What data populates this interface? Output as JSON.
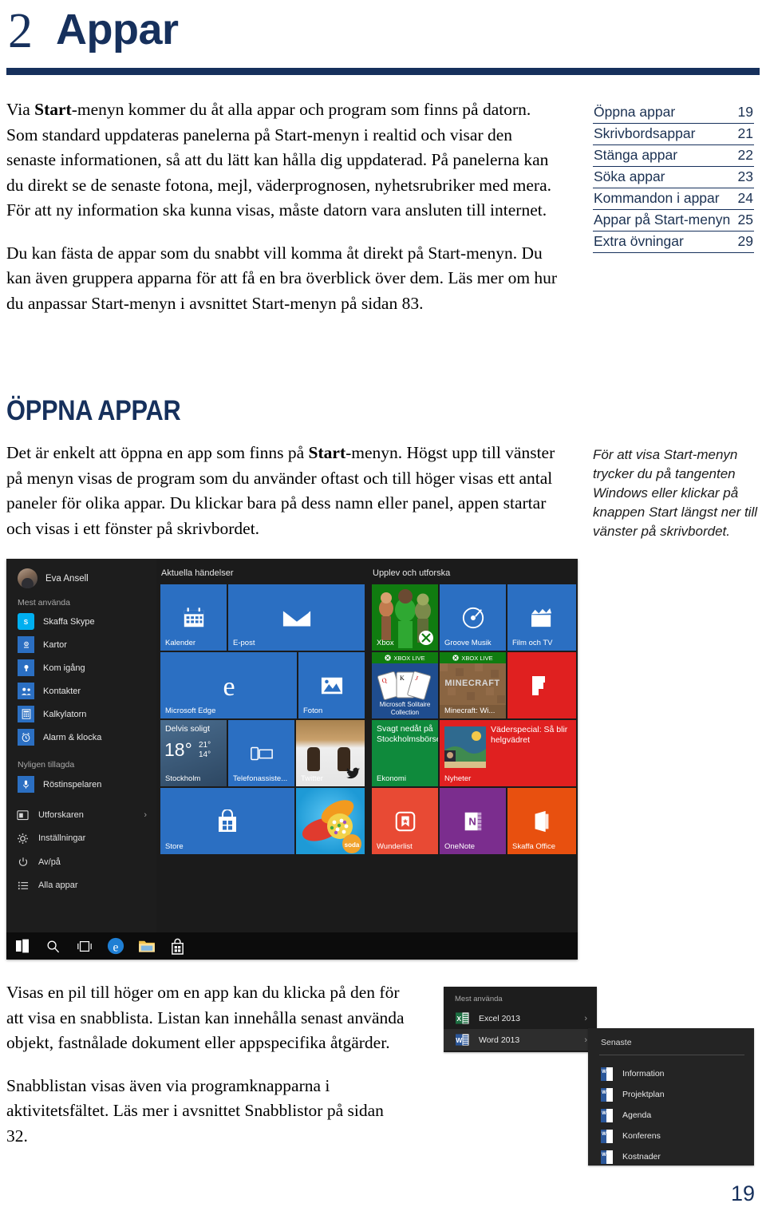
{
  "header": {
    "chapter_number": "2",
    "chapter_title": "Appar"
  },
  "toc": {
    "items": [
      {
        "label": "Öppna appar",
        "page": "19"
      },
      {
        "label": "Skrivbordsappar",
        "page": "21"
      },
      {
        "label": "Stänga appar",
        "page": "22"
      },
      {
        "label": "Söka appar",
        "page": "23"
      },
      {
        "label": "Kommandon i appar",
        "page": "24"
      },
      {
        "label": "Appar på Start-menyn",
        "page": "25"
      },
      {
        "label": "Extra övningar",
        "page": "29"
      }
    ]
  },
  "intro": {
    "para1_a": "Via ",
    "para1_b": "Start",
    "para1_c": "-menyn kommer du åt alla appar och program som finns på datorn. Som standard uppdateras panelerna på Start-menyn i realtid och visar den senaste informationen, så att du lätt kan hålla dig uppdaterad. På panelerna kan du direkt se de senaste fotona, mejl, väderprognosen, nyhetsrubriker med mera. För att ny information ska kunna visas, måste datorn vara ansluten till internet.",
    "para2": "Du kan fästa de appar som du snabbt vill komma åt direkt på Start-menyn. Du kan även gruppera apparna för att få en bra överblick över dem. Läs mer om hur du anpassar Start-menyn i avsnittet Start-menyn på sidan 83."
  },
  "section": {
    "heading": "ÖPPNA APPAR",
    "para_a": "Det är enkelt att öppna en app som finns på ",
    "para_b": "Start",
    "para_c": "-menyn. Högst upp till vänster på menyn visas de program som du använder oftast och till höger visas ett antal paneler för olika appar. Du klickar bara på dess namn eller panel, appen startar och visas i ett fönster på skrivbordet."
  },
  "side_note": "För att visa Start-menyn trycker du på tangenten Windows eller klickar på knappen Start längst ner till vänster på skrivbordet.",
  "start_menu": {
    "account_name": "Eva Ansell",
    "group_most_used": "Mest använda",
    "group_recently_added": "Nyligen tillagda",
    "most_used_apps": [
      {
        "name": "Skaffa Skype",
        "icon": "skype-icon",
        "color": "#00aff0"
      },
      {
        "name": "Kartor",
        "icon": "maps-icon",
        "color": "#2b6fc2"
      },
      {
        "name": "Kom igång",
        "icon": "lightbulb-icon",
        "color": "#2b6fc2"
      },
      {
        "name": "Kontakter",
        "icon": "people-icon",
        "color": "#2b6fc2"
      },
      {
        "name": "Kalkylatorn",
        "icon": "calculator-icon",
        "color": "#2b6fc2"
      },
      {
        "name": "Alarm & klocka",
        "icon": "alarm-clock-icon",
        "color": "#2b6fc2"
      }
    ],
    "recently_added_apps": [
      {
        "name": "Röstinspelaren",
        "icon": "microphone-icon",
        "color": "#2b6fc2"
      }
    ],
    "system_items": [
      {
        "name": "Utforskaren",
        "icon": "file-explorer-icon",
        "chevron": "›"
      },
      {
        "name": "Inställningar",
        "icon": "gear-icon",
        "chevron": ""
      },
      {
        "name": "Av/på",
        "icon": "power-icon",
        "chevron": ""
      },
      {
        "name": "Alla appar",
        "icon": "list-icon",
        "chevron": ""
      }
    ],
    "tile_group_1": {
      "title": "Aktuella händelser",
      "tiles": [
        {
          "label": "Kalender",
          "icon": "calendar-icon",
          "color": "#2b6fc2"
        },
        {
          "label": "E-post",
          "icon": "mail-icon",
          "color": "#2b6fc2"
        },
        {
          "label": "Microsoft Edge",
          "icon": "edge-icon",
          "color": "#2b6fc2"
        },
        {
          "label": "Foton",
          "icon": "photos-icon",
          "color": "#2b6fc2"
        },
        {
          "label": "Stockholm",
          "icon": "weather-icon",
          "color": "#3a5a7d",
          "condition": "Delvis soligt",
          "temp": "18°",
          "high": "21°",
          "low": "14°"
        },
        {
          "label": "Telefonassiste...",
          "icon": "phone-companion-icon",
          "color": "#2b6fc2"
        },
        {
          "label": "Twitter",
          "icon": "twitter-icon",
          "color": "#8a6a45"
        },
        {
          "label": "Store",
          "icon": "store-icon",
          "color": "#2b6fc2"
        },
        {
          "label": "Candy Crush Soda",
          "icon": "candy-crush-icon",
          "color": "#1e9ad6"
        }
      ]
    },
    "tile_group_2": {
      "title": "Upplev och utforska",
      "tiles": [
        {
          "label": "Xbox",
          "icon": "xbox-icon",
          "color": "#107c10"
        },
        {
          "label": "Groove Musik",
          "icon": "groove-icon",
          "color": "#2b6fc2"
        },
        {
          "label": "Film och TV",
          "icon": "movies-tv-icon",
          "color": "#2b6fc2"
        },
        {
          "label": "Microsoft Solitaire Collection",
          "icon": "solitaire-icon",
          "color": "#1f4d8f",
          "badge": "XBOX LIVE"
        },
        {
          "label": "Minecraft: Wi...",
          "icon": "minecraft-icon",
          "color": "#7b5a3a",
          "badge": "XBOX LIVE"
        },
        {
          "label": "Flipboard",
          "icon": "flipboard-icon",
          "color": "#e02020"
        },
        {
          "label": "Ekonomi",
          "icon": "finance-icon",
          "color": "#0f8a3c",
          "headline": "Svagt nedåt på Stockholmsbörsen"
        },
        {
          "label": "Nyheter",
          "icon": "news-icon",
          "color": "#e02020",
          "headline": "Väderspecial: Så blir helgvädret"
        },
        {
          "label": "Wunderlist",
          "icon": "wunderlist-icon",
          "color": "#e84a34"
        },
        {
          "label": "OneNote",
          "icon": "onenote-icon",
          "color": "#7b2d8e"
        },
        {
          "label": "Skaffa Office",
          "icon": "office-icon",
          "color": "#e8500f"
        }
      ]
    },
    "taskbar": [
      {
        "icon": "windows-start-icon"
      },
      {
        "icon": "search-icon"
      },
      {
        "icon": "task-view-icon"
      },
      {
        "icon": "edge-icon"
      },
      {
        "icon": "file-explorer-icon"
      },
      {
        "icon": "store-icon"
      }
    ]
  },
  "bottom": {
    "para1": "Visas en pil till höger om en app kan du klicka på den för att visa en snabblista. Listan kan innehålla senast använda objekt, fastnålade dokument eller appspecifika åtgärder.",
    "para2": "Snabblistan visas även via programknapparna i aktivitetsfältet. Läs mer i avsnittet Snabblistor på sidan 32."
  },
  "jumplist_most_used": {
    "header": "Mest använda",
    "items": [
      {
        "name": "Excel 2013",
        "icon": "excel-icon",
        "chevron": "›",
        "selected": false
      },
      {
        "name": "Word 2013",
        "icon": "word-icon",
        "chevron": "›",
        "selected": true
      }
    ]
  },
  "jumplist_recent": {
    "header": "Senaste",
    "items": [
      {
        "name": "Information",
        "icon": "word-doc-icon"
      },
      {
        "name": "Projektplan",
        "icon": "word-doc-icon"
      },
      {
        "name": "Agenda",
        "icon": "word-doc-icon"
      },
      {
        "name": "Konferens",
        "icon": "word-doc-icon"
      },
      {
        "name": "Kostnader",
        "icon": "word-doc-icon"
      }
    ]
  },
  "page_number": "19",
  "colors": {
    "brand_navy": "#16305c",
    "tile_blue": "#2b6fc2",
    "accent_red": "#e02020"
  }
}
